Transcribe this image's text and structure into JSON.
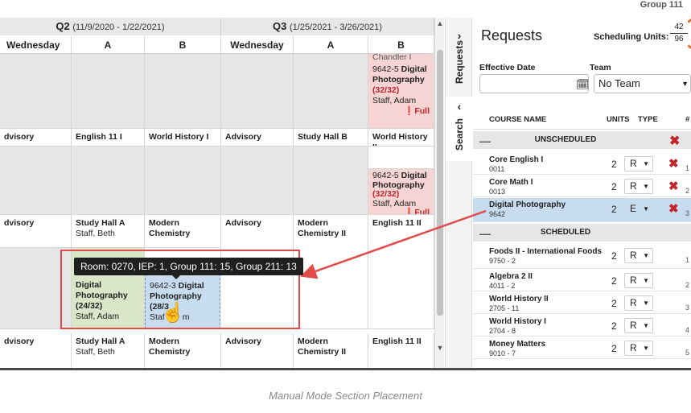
{
  "quarters": [
    {
      "name": "Q2",
      "range": "(11/9/2020 - 1/22/2021)"
    },
    {
      "name": "Q3",
      "range": "(1/25/2021 - 3/26/2021)"
    }
  ],
  "columns": [
    "Wednesday",
    "A",
    "B",
    "Wednesday",
    "A",
    "B"
  ],
  "cells": {
    "r2": {
      "c0": "dvisory",
      "c1": "English 11 I",
      "c2": "World History I",
      "c3": "Advisory",
      "c4": "Study Hall B",
      "c5": "World History II"
    },
    "r4": {
      "c0": "dvisory",
      "c1": "Study Hall A",
      "c1b": "Staff, Beth",
      "c2": "Modern",
      "c2b": "Chemistry",
      "c3": "Advisory",
      "c4": "Modern",
      "c4b": "Chemistry II",
      "c5": "English 11 II"
    },
    "r5": {
      "c0": "dvisory",
      "c1": "Study Hall A",
      "c1b": "Staff, Beth",
      "c2": "Modern",
      "c2b": "Chemistry",
      "c3": "Advisory",
      "c4": "Modern",
      "c4b": "Chemistry II",
      "c5": "English 11 II"
    }
  },
  "section_top": {
    "overflow": "Chandler I",
    "course": "9642-5",
    "title1": "Digital",
    "title2": "Photography",
    "seats": "(32/32)",
    "staff": "Staff, Adam",
    "status": "Full"
  },
  "section_mid": {
    "course": "9642-5",
    "title1": "Digital",
    "title2": "Photography",
    "seats": "(32/32)",
    "staff": "Staff, Adam",
    "status": "Full"
  },
  "section_green": {
    "line1": "Digital",
    "line2": "Photography",
    "seats": "(24/32)",
    "staff": "Staff, Adam"
  },
  "section_blue": {
    "course": "9642-3",
    "title1": "Digital",
    "title2": "Photography",
    "seats": "(28/3",
    "staff_a": "Staf",
    "staff_b": "m"
  },
  "tooltip": "Room: 0270, IEP: 1, Group 111: 15, Group 211: 13",
  "side_tabs": {
    "requests": "Requests",
    "search": "Search"
  },
  "panel": {
    "group": "Group 111",
    "title": "Requests",
    "scheduling_units_label": "Scheduling Units:",
    "units_num": "42",
    "units_den": "96",
    "effective_date_label": "Effective Date",
    "team_label": "Team",
    "team_value": "No Team",
    "col_course": "COURSE NAME",
    "col_units": "UNITS",
    "col_type": "TYPE",
    "col_rank": "#",
    "unscheduled_label": "UNSCHEDULED",
    "scheduled_label": "SCHEDULED",
    "unscheduled": [
      {
        "name": "Core English I",
        "code": "0011",
        "units": "2",
        "type": "R",
        "rank": "1"
      },
      {
        "name": "Core Math I",
        "code": "0013",
        "units": "2",
        "type": "R",
        "rank": "2"
      },
      {
        "name": "Digital Photography",
        "code": "9642",
        "units": "2",
        "type": "E",
        "rank": "3"
      }
    ],
    "scheduled": [
      {
        "name": "Foods II - International Foods",
        "code": "9750 - 2",
        "units": "2",
        "type": "R",
        "rank": "1"
      },
      {
        "name": "Algebra 2 II",
        "code": "4011 - 2",
        "units": "2",
        "type": "R",
        "rank": "2"
      },
      {
        "name": "World History II",
        "code": "2705 - 11",
        "units": "2",
        "type": "R",
        "rank": "3"
      },
      {
        "name": "World History I",
        "code": "2704 - 8",
        "units": "2",
        "type": "R",
        "rank": "4"
      },
      {
        "name": "Money Matters",
        "code": "9010 - 7",
        "units": "2",
        "type": "R",
        "rank": "5"
      }
    ]
  },
  "caption": "Manual Mode Section Placement",
  "colors": {
    "accent_red": "#e34a4a",
    "full_red": "#c0252b",
    "selected_blue": "#c8dcf0",
    "pink": "#f6d4d4",
    "green": "#d9e6c7",
    "orange": "#e8702a"
  },
  "icons": [
    "calendar-icon",
    "chevron-right-icon",
    "chevron-left-icon",
    "remove-x-icon",
    "collapse-dash-icon",
    "dropdown-caret-icon",
    "hand-pointer-icon",
    "error-circle-icon",
    "scroll-up-icon",
    "scroll-down-icon"
  ]
}
